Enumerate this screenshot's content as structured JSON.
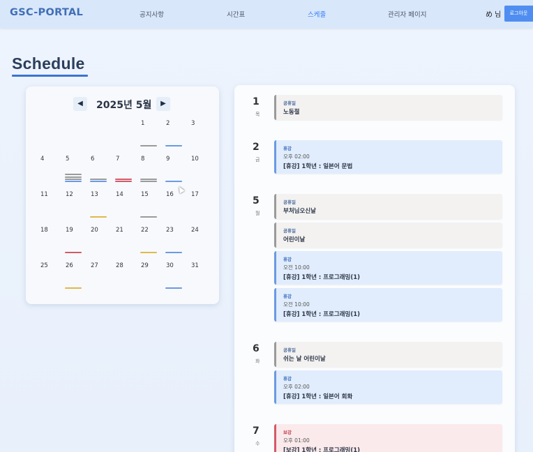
{
  "header": {
    "brand": "GSC-PORTAL",
    "nav": [
      "공지사항",
      "시간표",
      "스케줄",
      "관리자 페이지"
    ],
    "active_nav": "스케줄",
    "user": "め 님",
    "logout_label": "로그아웃"
  },
  "page": {
    "title": "Schedule"
  },
  "calendar": {
    "month_label": "2025년 5월",
    "prev_icon": "left-triangle-icon",
    "next_icon": "right-triangle-icon",
    "weeks": [
      [
        "",
        "",
        "",
        "",
        "1",
        "2",
        "3"
      ],
      [
        "4",
        "5",
        "6",
        "7",
        "8",
        "9",
        "10"
      ],
      [
        "11",
        "12",
        "13",
        "14",
        "15",
        "16",
        "17"
      ],
      [
        "18",
        "19",
        "20",
        "21",
        "22",
        "23",
        "24"
      ],
      [
        "25",
        "26",
        "27",
        "28",
        "29",
        "30",
        "31"
      ]
    ],
    "markers": {
      "1": [
        "#9a9a9a"
      ],
      "2": [
        "#6b9ae2"
      ],
      "5": [
        "#9a9a9a",
        "#9a9a9a",
        "#9a9a9a",
        "#6b9ae2"
      ],
      "6": [
        "#9a9a9a",
        "#6b9ae2"
      ],
      "7": [
        "#d35a66",
        "#d35a66"
      ],
      "8": [
        "#9a9a9a",
        "#9a9a9a"
      ],
      "9": [
        "#6b9ae2"
      ],
      "13": [
        "#e0b84a"
      ],
      "15": [
        "#9a9a9a"
      ],
      "19": [
        "#d35a66"
      ],
      "22": [
        "#e0b84a"
      ],
      "23": [
        "#6b9ae2"
      ],
      "26": [
        "#e0b84a"
      ],
      "30": [
        "#6b9ae2"
      ]
    }
  },
  "colors": {
    "holiday": "#9a9a9a",
    "cancel": "#6b9ae2",
    "makeup": "#d35a66",
    "other": "#e0b84a",
    "accent": "#3b74cf"
  },
  "schedule": [
    {
      "day": "1",
      "dow": "목",
      "events": [
        {
          "kind": "holiday",
          "type": "공휴일",
          "time": "",
          "title": "노동절"
        }
      ]
    },
    {
      "day": "2",
      "dow": "금",
      "events": [
        {
          "kind": "cancel",
          "type": "휴강",
          "time": "오후 02:00",
          "title": "[휴강] 1학년 : 일본어 문법"
        }
      ]
    },
    {
      "day": "5",
      "dow": "월",
      "events": [
        {
          "kind": "holiday",
          "type": "공휴일",
          "time": "",
          "title": "부처님오신날"
        },
        {
          "kind": "holiday",
          "type": "공휴일",
          "time": "",
          "title": "어린이날"
        },
        {
          "kind": "cancel",
          "type": "휴강",
          "time": "오전 10:00",
          "title": "[휴강] 1학년 : 프로그래밍(1)"
        },
        {
          "kind": "cancel",
          "type": "휴강",
          "time": "오전 10:00",
          "title": "[휴강] 1학년 : 프로그래밍(1)"
        }
      ]
    },
    {
      "day": "6",
      "dow": "화",
      "events": [
        {
          "kind": "holiday",
          "type": "공휴일",
          "time": "",
          "title": "쉬는 날 어린이날"
        },
        {
          "kind": "cancel",
          "type": "휴강",
          "time": "오후 02:00",
          "title": "[휴강] 1학년 : 일본어 회화"
        }
      ]
    },
    {
      "day": "7",
      "dow": "수",
      "events": [
        {
          "kind": "makeup",
          "type": "보강",
          "time": "오후 01:00",
          "title": "[보강] 1학년 : 프로그래밍(1)"
        }
      ]
    }
  ]
}
